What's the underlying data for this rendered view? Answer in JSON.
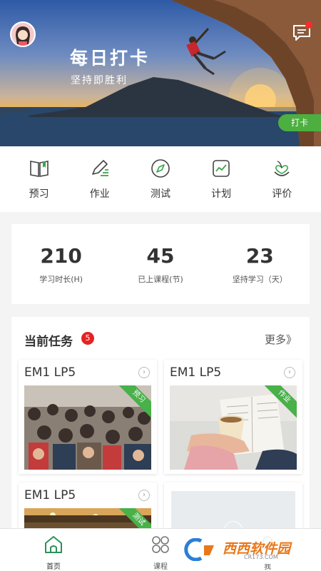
{
  "hero": {
    "title": "每日打卡",
    "subtitle": "坚持即胜利",
    "checkin_label": "打卡",
    "has_unread_message": true
  },
  "nav": [
    {
      "label": "预习",
      "icon": "book-icon"
    },
    {
      "label": "作业",
      "icon": "pencil-icon"
    },
    {
      "label": "测试",
      "icon": "compass-icon"
    },
    {
      "label": "计划",
      "icon": "chart-icon"
    },
    {
      "label": "评价",
      "icon": "heart-sprout-icon"
    }
  ],
  "stats": [
    {
      "value": "210",
      "caption": "学习时长(H)"
    },
    {
      "value": "45",
      "caption": "已上课程(节)"
    },
    {
      "value": "23",
      "caption": "坚持学习（天）"
    }
  ],
  "tasks": {
    "title": "当前任务",
    "count": "5",
    "more_label": "更多》",
    "cards": [
      {
        "title": "EM1 LP5",
        "tag": "预习",
        "image": "crowd-photo"
      },
      {
        "title": "EM1 LP5",
        "tag": "作业",
        "image": "reading-coffee-photo"
      },
      {
        "title": "EM1 LP5",
        "tag": "测试",
        "image": "interior-photo"
      },
      {
        "title": "",
        "tag": "",
        "image": "placeholder"
      }
    ]
  },
  "tabbar": [
    {
      "label": "首页",
      "icon": "home-icon",
      "active": true
    },
    {
      "label": "课程",
      "icon": "grid-icon",
      "active": false
    },
    {
      "label": "我",
      "icon": "user-icon",
      "active": false
    }
  ],
  "watermark": {
    "text": "西西软件园",
    "url": "CR173.COM"
  },
  "colors": {
    "accent_green": "#4caf3f",
    "badge_red": "#e52222"
  }
}
